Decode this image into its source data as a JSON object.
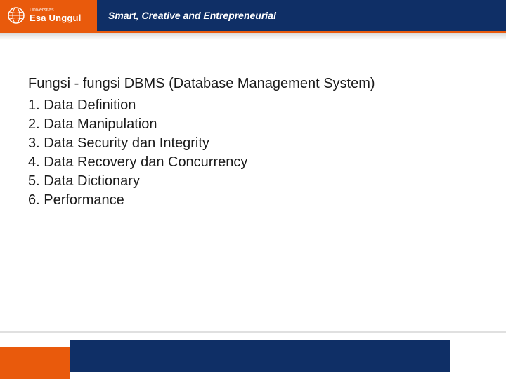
{
  "header": {
    "logo_small": "Universitas",
    "logo_big": "Esa Unggul",
    "tagline": "Smart, Creative and Entrepreneurial"
  },
  "content": {
    "title": "Fungsi - fungsi DBMS (Database Management System)",
    "items": [
      "1. Data Definition",
      "2. Data Manipulation",
      "3. Data Security dan Integrity",
      "4. Data Recovery dan Concurrency",
      "5. Data Dictionary",
      "6. Performance"
    ]
  }
}
